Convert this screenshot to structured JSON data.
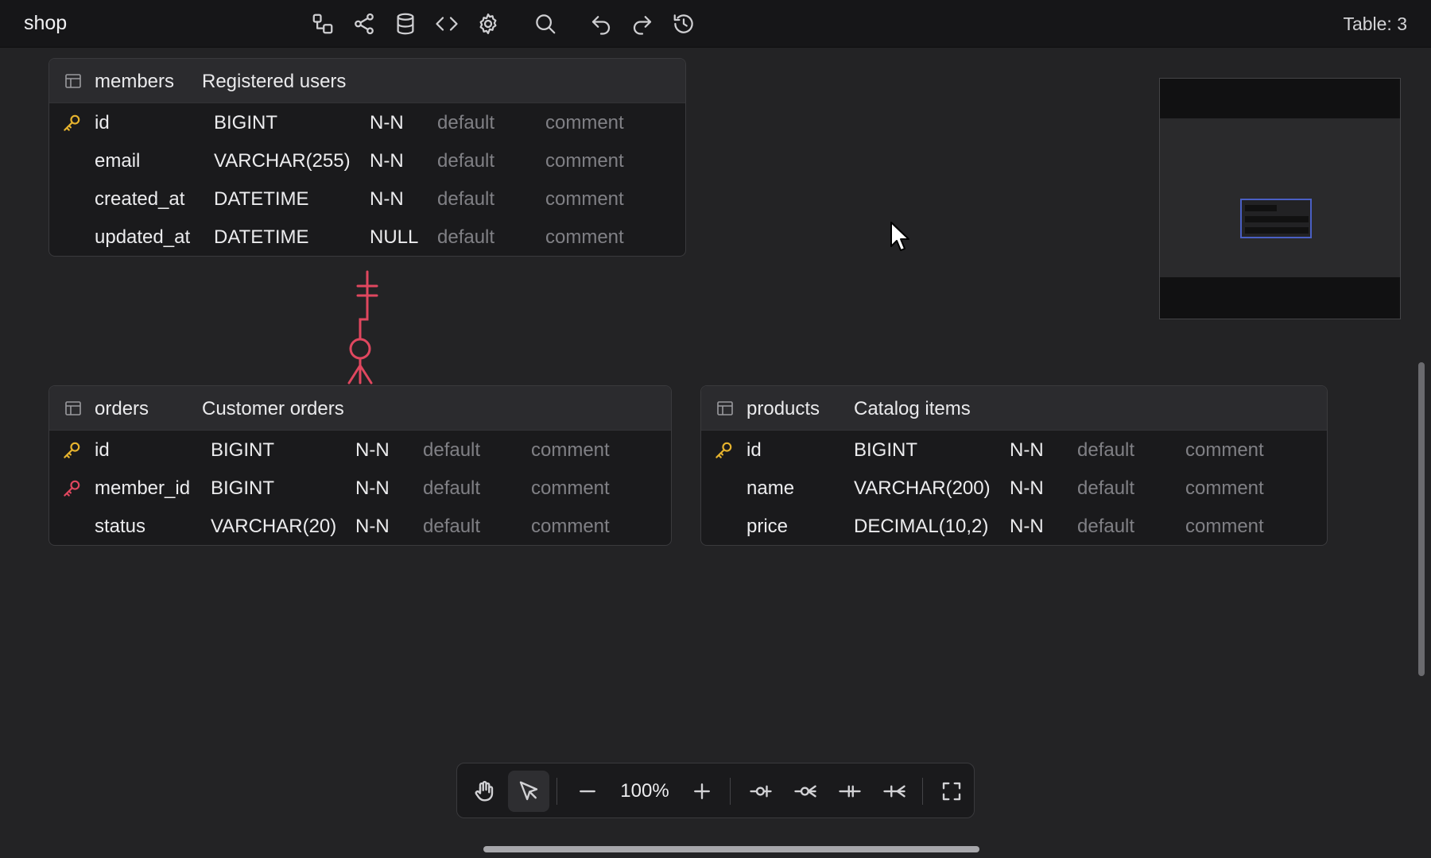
{
  "app": {
    "title": "shop",
    "table_count": "Table: 3"
  },
  "toolbar": {
    "icons": [
      "layout-icon",
      "share-icon",
      "database-icon",
      "code-icon",
      "gear-icon",
      "search-icon",
      "undo-icon",
      "redo-icon",
      "history-icon"
    ]
  },
  "tables": {
    "members": {
      "name": "members",
      "comment": "Registered users",
      "columns": [
        {
          "key": "pk",
          "name": "id",
          "type": "BIGINT",
          "null": "N-N",
          "default": "default",
          "comment": "comment"
        },
        {
          "key": "",
          "name": "email",
          "type": "VARCHAR(255)",
          "null": "N-N",
          "default": "default",
          "comment": "comment"
        },
        {
          "key": "",
          "name": "created_at",
          "type": "DATETIME",
          "null": "N-N",
          "default": "default",
          "comment": "comment"
        },
        {
          "key": "",
          "name": "updated_at",
          "type": "DATETIME",
          "null": "NULL",
          "default": "default",
          "comment": "comment"
        }
      ]
    },
    "orders": {
      "name": "orders",
      "comment": "Customer orders",
      "columns": [
        {
          "key": "pk",
          "name": "id",
          "type": "BIGINT",
          "null": "N-N",
          "default": "default",
          "comment": "comment"
        },
        {
          "key": "fk",
          "name": "member_id",
          "type": "BIGINT",
          "null": "N-N",
          "default": "default",
          "comment": "comment"
        },
        {
          "key": "",
          "name": "status",
          "type": "VARCHAR(20)",
          "null": "N-N",
          "default": "default",
          "comment": "comment"
        }
      ]
    },
    "products": {
      "name": "products",
      "comment": "Catalog items",
      "columns": [
        {
          "key": "pk",
          "name": "id",
          "type": "BIGINT",
          "null": "N-N",
          "default": "default",
          "comment": "comment"
        },
        {
          "key": "",
          "name": "name",
          "type": "VARCHAR(200)",
          "null": "N-N",
          "default": "default",
          "comment": "comment"
        },
        {
          "key": "",
          "name": "price",
          "type": "DECIMAL(10,2)",
          "null": "N-N",
          "default": "default",
          "comment": "comment"
        }
      ]
    }
  },
  "relation": {
    "from": "members.id",
    "to": "orders.member_id",
    "cardinality": "one-to-zero-or-many",
    "color": "#e0475f"
  },
  "bottom_toolbar": {
    "zoom": "100%"
  },
  "colors": {
    "accent": "#4a5fc4",
    "primary_key": "#e6b32e",
    "foreign_key": "#e0475f",
    "background": "#232325"
  }
}
